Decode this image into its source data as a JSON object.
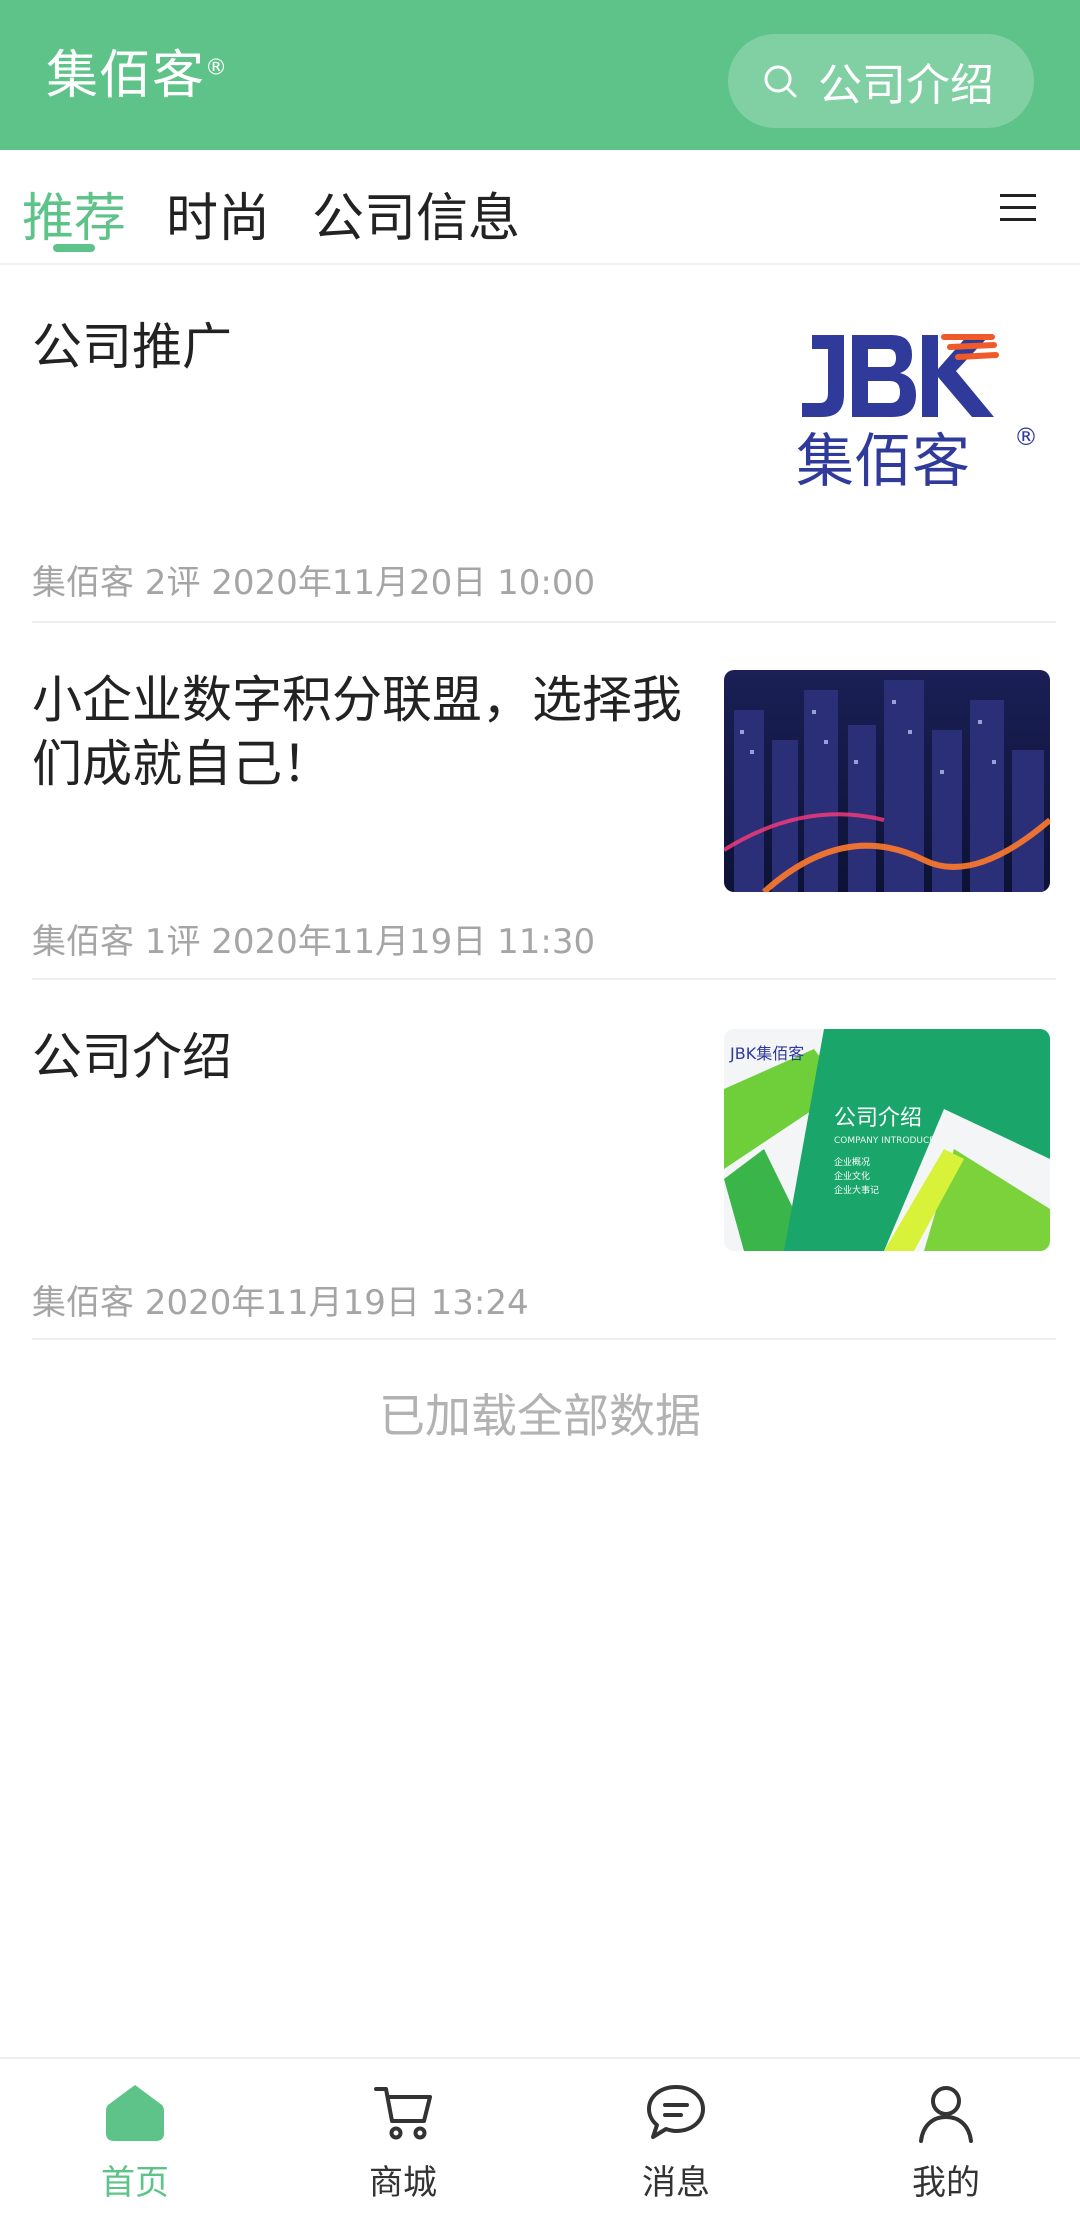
{
  "header": {
    "brand": "集佰客",
    "brand_mark": "®",
    "search_label": "公司介绍"
  },
  "tabs": [
    {
      "label": "推荐",
      "active": true
    },
    {
      "label": "时尚",
      "active": false
    },
    {
      "label": "公司信息",
      "active": false
    }
  ],
  "articles": [
    {
      "title": "公司推广",
      "meta": "集佰客 2评 2020年11月20日 10:00",
      "thumb": "jbk-logo",
      "logo_text": "集佰客",
      "logo_letters": "JBK"
    },
    {
      "title": "小企业数字积分联盟，选择我们成就自己！",
      "meta": "集佰客 1评 2020年11月19日 11:30",
      "thumb": "city-night"
    },
    {
      "title": "公司介绍",
      "meta": "集佰客 2020年11月19日 13:24",
      "thumb": "company-intro-card",
      "card": {
        "brand": "JBK集佰客",
        "title": "公司介绍",
        "subtitle": "COMPANY INTRODUCE",
        "lines": [
          "企业概况",
          "企业文化",
          "企业大事记"
        ]
      }
    }
  ],
  "end_text": "已加载全部数据",
  "bottom_nav": [
    {
      "label": "首页",
      "icon": "home-icon",
      "active": true
    },
    {
      "label": "商城",
      "icon": "cart-icon",
      "active": false
    },
    {
      "label": "消息",
      "icon": "message-icon",
      "active": false
    },
    {
      "label": "我的",
      "icon": "user-icon",
      "active": false
    }
  ],
  "colors": {
    "accent": "#5ec389",
    "logo_blue": "#2f3a9a",
    "logo_orange": "#f05a28"
  }
}
